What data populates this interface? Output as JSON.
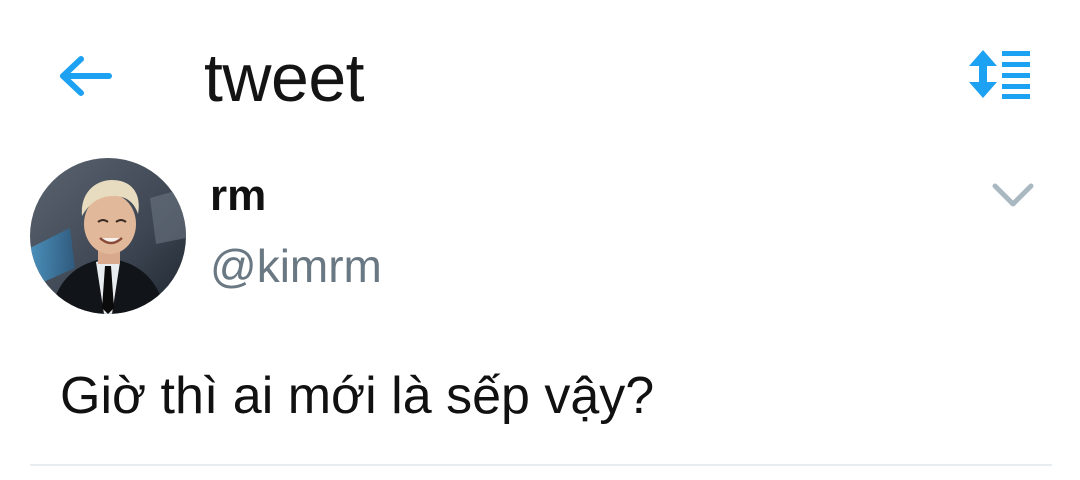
{
  "header": {
    "title": "tweet",
    "back_icon": "back-arrow-icon",
    "sort_icon": "sort-list-icon"
  },
  "tweet": {
    "display_name": "rm",
    "handle": "@kimrm",
    "text": "Giờ thì ai mới là sếp vậy?",
    "menu_icon": "chevron-down-icon",
    "avatar": "profile-photo"
  },
  "colors": {
    "accent": "#1DA1F2",
    "handle": "#697882",
    "chevron": "#AAB8C2",
    "divider": "#E6ECF0",
    "text": "#111111"
  }
}
